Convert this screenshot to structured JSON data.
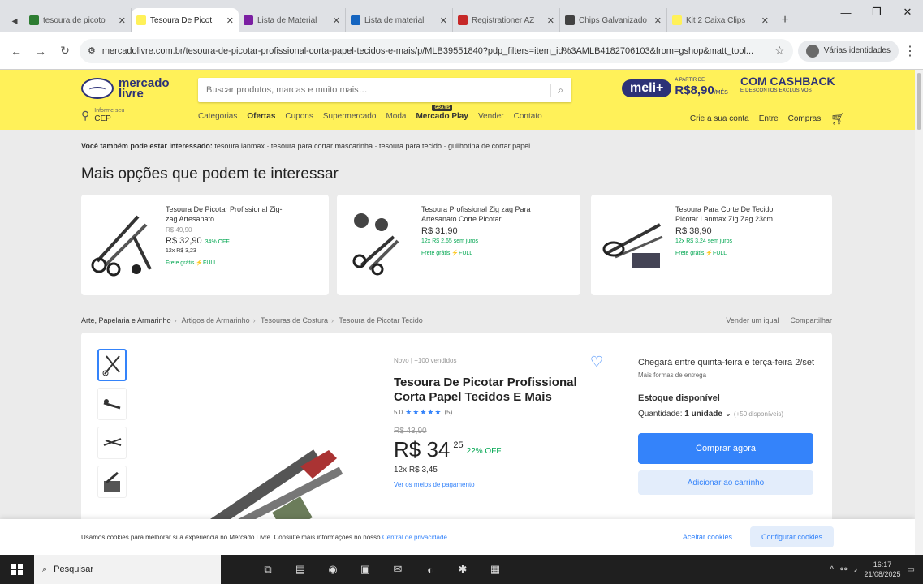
{
  "browser": {
    "tabs": [
      {
        "title": "tesoura de picoto",
        "color": "#2e7d32",
        "active": false
      },
      {
        "title": "Tesoura De Picot",
        "color": "#fff159",
        "active": true
      },
      {
        "title": "Lista de Material",
        "color": "#7b1fa2",
        "active": false
      },
      {
        "title": "Lista de material",
        "color": "#1565c0",
        "active": false
      },
      {
        "title": "Registrationer AZ",
        "color": "#c62828",
        "active": false
      },
      {
        "title": "Chips Galvanizado",
        "color": "#424242",
        "active": false
      },
      {
        "title": "Kit 2 Caixa Clips",
        "color": "#fff159",
        "active": false
      }
    ],
    "new_tab": "+",
    "url": "mercadolivre.com.br/tesoura-de-picotar-profissional-corta-papel-tecidos-e-mais/p/MLB39551840?pdp_filters=item_id%3AMLB4182706103&from=gshop&matt_tool...",
    "session_label": "Várias identidades"
  },
  "ml": {
    "logo_text_1": "mercado",
    "logo_text_2": "livre",
    "search_placeholder": "Buscar produtos, marcas e muito mais…",
    "meli_badge": "meli+",
    "meli_pre": "A PARTIR DE",
    "meli_price": "R$8,90",
    "meli_suffix": "/MÊS",
    "cashback_title": "COM CASHBACK",
    "cashback_sub": "E DESCONTOS EXCLUSIVOS",
    "cep_line1": "Informe seu",
    "cep_line2": "CEP",
    "nav": [
      "Categorias",
      "Ofertas",
      "Cupons",
      "Supermercado",
      "Moda",
      "Mercado Play",
      "Vender",
      "Contato"
    ],
    "mp_new": "GRÁTIS",
    "user_nav": [
      "Crie a sua conta",
      "Entre",
      "Compras"
    ]
  },
  "suggest": {
    "lead": "Você também pode estar interessado:",
    "items": "tesoura lanmax · tesoura para cortar mascarinha · tesoura para tecido · guilhotina de cortar papel"
  },
  "section_title": "Mais opções que podem te interessar",
  "recs": [
    {
      "title": "Tesoura De Picotar Profissional Zig-zag Artesanato",
      "old": "R$ 49,90",
      "price": "R$ 32,90",
      "off": "34% OFF",
      "inst": "12x R$ 3,23",
      "inst_green": false,
      "ship": "Frete grátis ⚡FULL"
    },
    {
      "title": "Tesoura Profissional Zig zag Para Artesanato Corte Picotar",
      "old": "",
      "price": "R$ 31,90",
      "off": "",
      "inst": "12x R$ 2,65 sem juros",
      "inst_green": true,
      "ship": "Frete grátis ⚡FULL"
    },
    {
      "title": "Tesoura Para Corte De Tecido Picotar Lanmax Zig Zag 23cm...",
      "old": "",
      "price": "R$ 38,90",
      "off": "",
      "inst": "12x R$ 3,24 sem juros",
      "inst_green": true,
      "ship": "Frete grátis ⚡FULL"
    }
  ],
  "breadcrumb": [
    "Arte, Papelaria e Armarinho",
    "Artigos de Armarinho",
    "Tesouras de Costura",
    "Tesoura de Picotar Tecido"
  ],
  "bc_actions": [
    "Vender um igual",
    "Compartilhar"
  ],
  "product": {
    "condition": "Novo  |  +100 vendidos",
    "title": "Tesoura De Picotar Profissional Corta Papel Tecidos E Mais",
    "rating_value": "5.0",
    "rating_count": "(5)",
    "old_price": "R$ 43,90",
    "price_int": "R$ 34",
    "price_cents": "25",
    "off": "22% OFF",
    "installments": "12x R$ 3,45",
    "payment_link": "Ver os meios de pagamento"
  },
  "buybox": {
    "arrival": "Chegará entre quinta-feira e terça-feira 2/set",
    "more": "Mais formas de entrega",
    "stock": "Estoque disponível",
    "qty_label": "Quantidade:",
    "qty_value": "1 unidade",
    "qty_avail": "(+50 disponíveis)",
    "buy": "Comprar agora",
    "cart": "Adicionar ao carrinho"
  },
  "cookie": {
    "msg": "Usamos cookies para melhorar sua experiência no Mercado Livre. Consulte mais informações no nosso",
    "link": "Central de privacidade",
    "accept": "Aceitar cookies",
    "config": "Configurar cookies"
  },
  "taskbar": {
    "search": "Pesquisar",
    "time": "16:17",
    "date": "21/08/2025"
  }
}
